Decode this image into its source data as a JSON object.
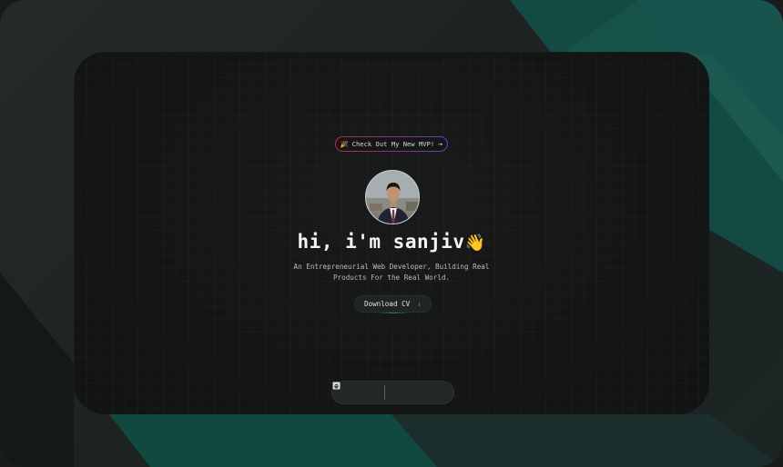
{
  "announcement": {
    "emoji": "🎉",
    "label": "Check Out My New MVP!",
    "arrow": "→"
  },
  "profile": {
    "avatar_alt": "profile photo"
  },
  "hero": {
    "greeting": "hi, i'm sanjiv",
    "wave_emoji": "👋",
    "tagline_line1": "An Entrepreneurial Web Developer, Building Real",
    "tagline_line2": "Products For the Real World."
  },
  "cta": {
    "download_label": "Download CV",
    "download_icon": "↓"
  },
  "dock": {
    "items": [
      {
        "icon": "home-icon"
      },
      {
        "icon": "code-icon"
      },
      {
        "icon": "notebook-icon"
      },
      {
        "icon": "linkedin-icon"
      },
      {
        "icon": "x-icon"
      },
      {
        "icon": "github-icon"
      },
      {
        "icon": "mail-icon"
      }
    ]
  },
  "colors": {
    "accent_teal": "#0f5a50",
    "window_bg": "#141616",
    "pill_gradient_start": "#c0264b",
    "pill_gradient_end": "#6a3fd1"
  }
}
